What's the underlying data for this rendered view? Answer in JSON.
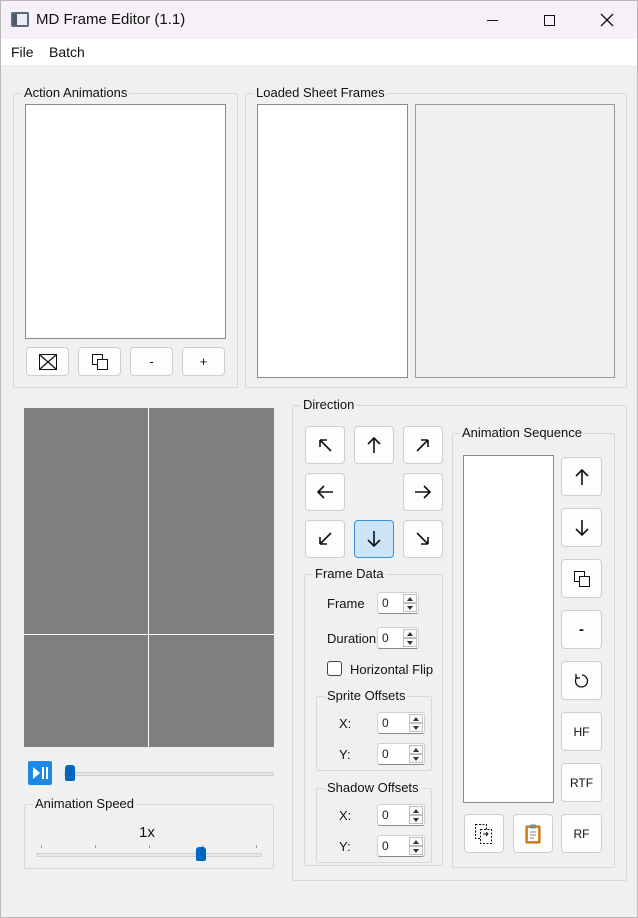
{
  "window": {
    "title": "MD Frame Editor (1.1)"
  },
  "menu": {
    "file": "File",
    "batch": "Batch"
  },
  "action_animations": {
    "title": "Action Animations",
    "buttons": {
      "minus": "-",
      "plus": "+"
    }
  },
  "loaded_sheet_frames": {
    "title": "Loaded Sheet Frames"
  },
  "direction": {
    "title": "Direction",
    "selected": "down"
  },
  "frame_data": {
    "title": "Frame Data",
    "frame_label": "Frame",
    "frame_value": "0",
    "duration_label": "Duration",
    "duration_value": "0",
    "flip_label": "Horizontal Flip",
    "flip_checked": false
  },
  "sprite_offsets": {
    "title": "Sprite Offsets",
    "x_label": "X:",
    "x_value": "0",
    "y_label": "Y:",
    "y_value": "0"
  },
  "shadow_offsets": {
    "title": "Shadow Offsets",
    "x_label": "X:",
    "x_value": "0",
    "y_label": "Y:",
    "y_value": "0"
  },
  "animation_sequence": {
    "title": "Animation Sequence",
    "buttons": {
      "remove": "-",
      "hf": "HF",
      "rtf": "RTF",
      "rf": "RF"
    }
  },
  "playback": {
    "position": 0
  },
  "animation_speed": {
    "title": "Animation Speed",
    "value_label": "1x",
    "position": 0.74
  },
  "colors": {
    "accent": "#0067c0",
    "play": "#1e88e5",
    "preview_bg": "#7f7f7f",
    "active_btn": "#cce4f7"
  }
}
